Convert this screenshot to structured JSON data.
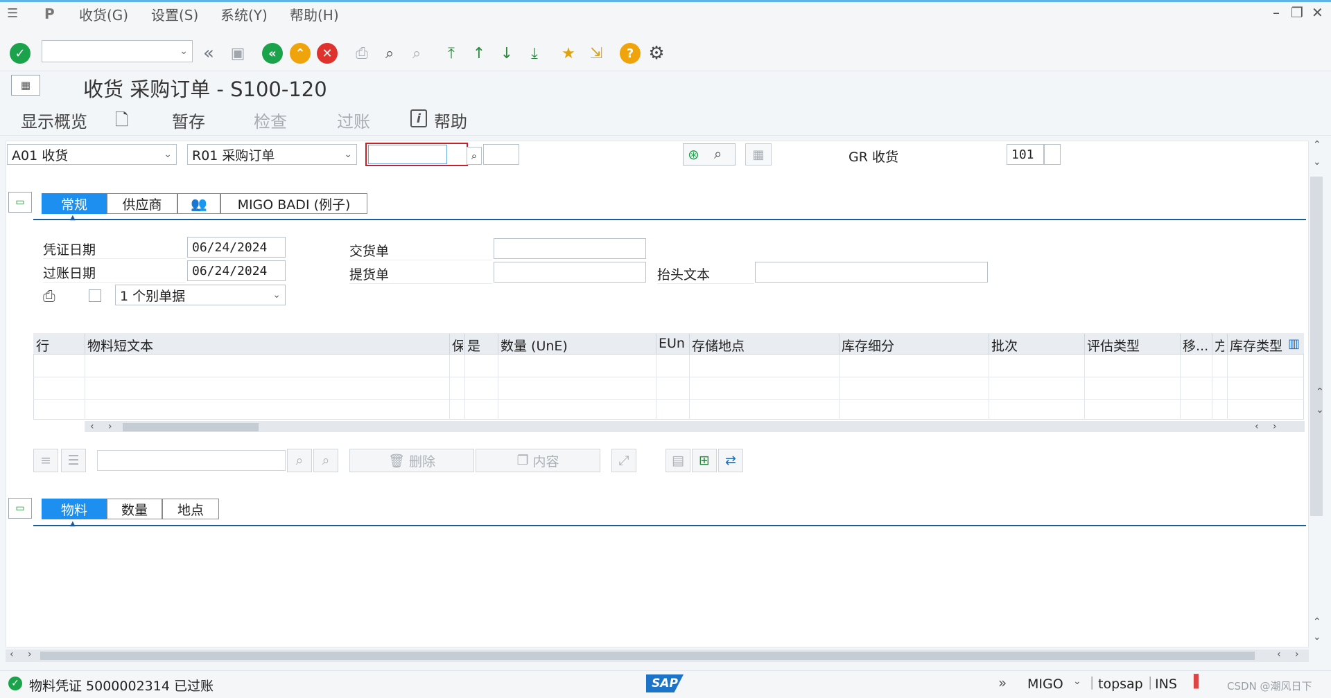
{
  "menubar": {
    "items": [
      "收货(G)",
      "设置(S)",
      "系统(Y)",
      "帮助(H)"
    ]
  },
  "toolbar": {
    "command_field_value": ""
  },
  "title": "收货 采购订单 - S100-120",
  "app_toolbar": {
    "overview": "显示概览",
    "hold": "暂存",
    "check": "检查",
    "post": "过账",
    "help": "帮助"
  },
  "header_row": {
    "action": "A01 收货",
    "reference": "R01 采购订单",
    "po_number": "",
    "movement_label": "GR 收货",
    "movement_type": "101"
  },
  "header_tabs": [
    "常规",
    "供应商",
    "MIGO BADI (例子)"
  ],
  "general": {
    "doc_date_label": "凭证日期",
    "doc_date": "06/24/2024",
    "post_date_label": "过账日期",
    "post_date": "06/24/2024",
    "delivery_note_label": "交货单",
    "delivery_note": "",
    "bill_of_lading_label": "提货单",
    "bill_of_lading": "",
    "header_text_label": "抬头文本",
    "header_text": "",
    "print_option": "1 个别单据"
  },
  "grid": {
    "columns": [
      "行",
      "物料短文本",
      "保",
      "是",
      "数量 (UnE)",
      "EUn",
      "存储地点",
      "库存细分",
      "批次",
      "评估类型",
      "移...",
      "方",
      "库存类型"
    ]
  },
  "grid_buttons": {
    "delete": "删除",
    "contents": "内容"
  },
  "detail_tabs": [
    "物料",
    "数量",
    "地点"
  ],
  "status": {
    "message": "物料凭证 5000002314 已过账",
    "transaction": "MIGO",
    "system": "topsap",
    "mode": "INS",
    "watermark": "CSDN @潮风日下"
  },
  "colors": {
    "accent": "#1d8ff0",
    "tab_line": "#1b5c9c",
    "ok_green": "#1aa34a",
    "exit_orange": "#f0a40b",
    "cancel_red": "#e0322d"
  }
}
